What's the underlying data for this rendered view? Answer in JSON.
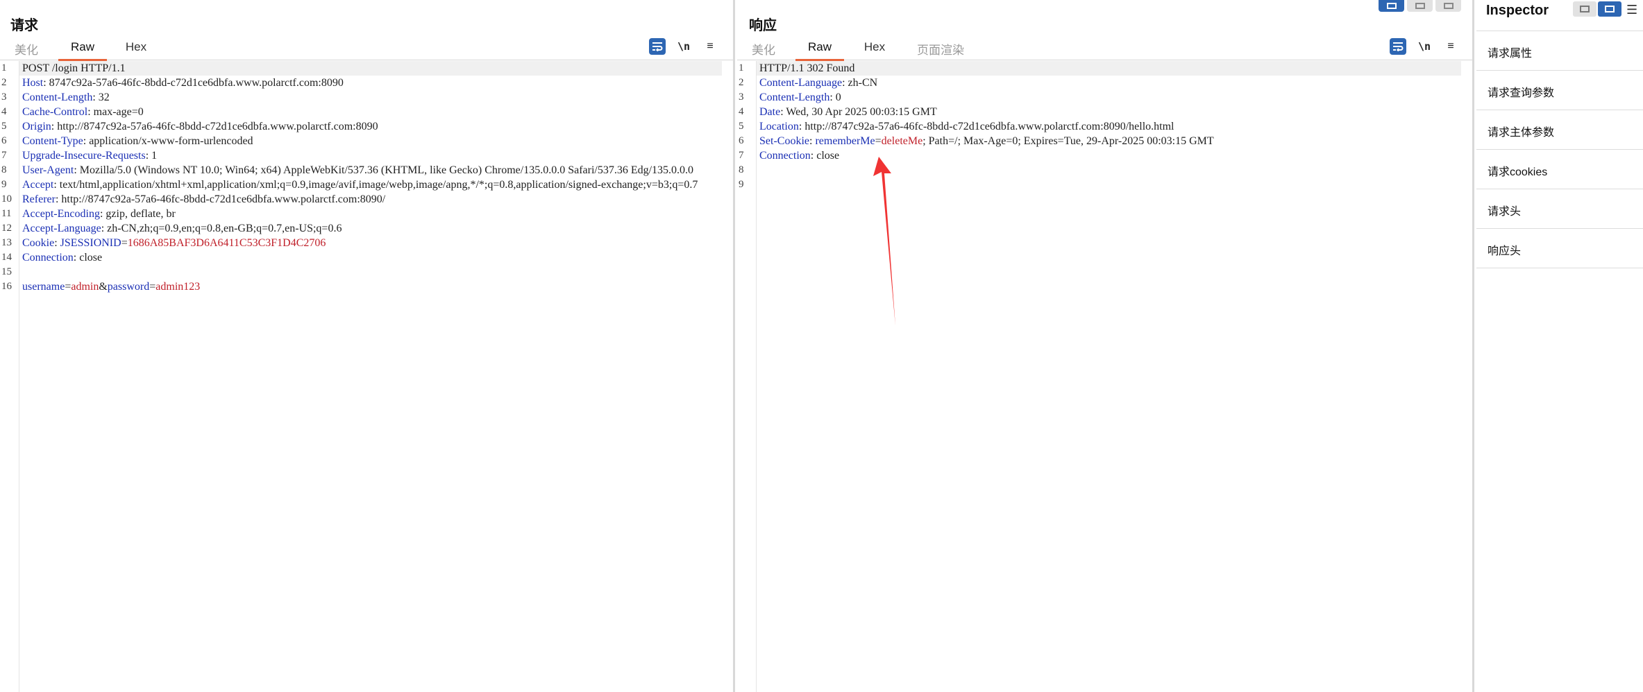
{
  "request": {
    "title": "请求",
    "tabs": [
      "美化",
      "Raw",
      "Hex"
    ],
    "active_tab": "Raw",
    "toolbar": {
      "newline_label": "\\n",
      "menu_label": "≡"
    },
    "lines": [
      [
        {
          "t": "POST /login HTTP/1.1",
          "c": ""
        }
      ],
      [
        {
          "t": "Host",
          "c": "hk"
        },
        {
          "t": ": 8747c92a-57a6-46fc-8bdd-c72d1ce6dbfa.www.polarctf.com:8090",
          "c": "hv"
        }
      ],
      [
        {
          "t": "Content-Length",
          "c": "hk"
        },
        {
          "t": ": 32",
          "c": "hv"
        }
      ],
      [
        {
          "t": "Cache-Control",
          "c": "hk"
        },
        {
          "t": ": max-age=0",
          "c": "hv"
        }
      ],
      [
        {
          "t": "Origin",
          "c": "hk"
        },
        {
          "t": ": http://8747c92a-57a6-46fc-8bdd-c72d1ce6dbfa.www.polarctf.com:8090",
          "c": "hv"
        }
      ],
      [
        {
          "t": "Content-Type",
          "c": "hk"
        },
        {
          "t": ": application/x-www-form-urlencoded",
          "c": "hv"
        }
      ],
      [
        {
          "t": "Upgrade-Insecure-Requests",
          "c": "hk"
        },
        {
          "t": ": 1",
          "c": "hv"
        }
      ],
      [
        {
          "t": "User-Agent",
          "c": "hk"
        },
        {
          "t": ": Mozilla/5.0 (Windows NT 10.0; Win64; x64) AppleWebKit/537.36 (KHTML, like Gecko) Chrome/135.0.0.0 Safari/537.36 Edg/135.0.0.0",
          "c": "hv"
        }
      ],
      [
        {
          "t": "Accept",
          "c": "hk"
        },
        {
          "t": ": text/html,application/xhtml+xml,application/xml;q=0.9,image/avif,image/webp,image/apng,*/*;q=0.8,application/signed-exchange;v=b3;q=0.7",
          "c": "hv"
        }
      ],
      [
        {
          "t": "Referer",
          "c": "hk"
        },
        {
          "t": ": http://8747c92a-57a6-46fc-8bdd-c72d1ce6dbfa.www.polarctf.com:8090/",
          "c": "hv"
        }
      ],
      [
        {
          "t": "Accept-Encoding",
          "c": "hk"
        },
        {
          "t": ": gzip, deflate, br",
          "c": "hv"
        }
      ],
      [
        {
          "t": "Accept-Language",
          "c": "hk"
        },
        {
          "t": ": zh-CN,zh;q=0.9,en;q=0.8,en-GB;q=0.7,en-US;q=0.6",
          "c": "hv"
        }
      ],
      [
        {
          "t": "Cookie",
          "c": "hk"
        },
        {
          "t": ": ",
          "c": "hv"
        },
        {
          "t": "JSESSIONID",
          "c": "pk"
        },
        {
          "t": "=",
          "c": "hv"
        },
        {
          "t": "1686A85BAF3D6A6411C53C3F1D4C2706",
          "c": "pv"
        }
      ],
      [
        {
          "t": "Connection",
          "c": "hk"
        },
        {
          "t": ": close",
          "c": "hv"
        }
      ],
      [
        {
          "t": "",
          "c": ""
        }
      ],
      [
        {
          "t": "username",
          "c": "pk"
        },
        {
          "t": "=",
          "c": "hv"
        },
        {
          "t": "admin",
          "c": "pv"
        },
        {
          "t": "&",
          "c": "hv"
        },
        {
          "t": "password",
          "c": "pk"
        },
        {
          "t": "=",
          "c": "hv"
        },
        {
          "t": "admin123",
          "c": "pv"
        }
      ]
    ]
  },
  "response": {
    "title": "响应",
    "tabs": [
      "美化",
      "Raw",
      "Hex",
      "页面渲染"
    ],
    "active_tab": "Raw",
    "toolbar": {
      "newline_label": "\\n",
      "menu_label": "≡"
    },
    "lines": [
      [
        {
          "t": "HTTP/1.1 302 Found",
          "c": ""
        }
      ],
      [
        {
          "t": "Content-Language",
          "c": "hk"
        },
        {
          "t": ": zh-CN",
          "c": "hv"
        }
      ],
      [
        {
          "t": "Content-Length",
          "c": "hk"
        },
        {
          "t": ": 0",
          "c": "hv"
        }
      ],
      [
        {
          "t": "Date",
          "c": "hk"
        },
        {
          "t": ": Wed, 30 Apr 2025 00:03:15 GMT",
          "c": "hv"
        }
      ],
      [
        {
          "t": "Location",
          "c": "hk"
        },
        {
          "t": ": http://8747c92a-57a6-46fc-8bdd-c72d1ce6dbfa.www.polarctf.com:8090/hello.html",
          "c": "hv"
        }
      ],
      [
        {
          "t": "Set-Cookie",
          "c": "hk"
        },
        {
          "t": ": ",
          "c": "hv"
        },
        {
          "t": "rememberMe",
          "c": "pk"
        },
        {
          "t": "=",
          "c": "hv"
        },
        {
          "t": "deleteMe",
          "c": "pv"
        },
        {
          "t": "; Path=/; Max-Age=0; Expires=Tue, 29-Apr-2025 00:03:15 GMT",
          "c": "hv"
        }
      ],
      [
        {
          "t": "Connection",
          "c": "hk"
        },
        {
          "t": ": close",
          "c": "hv"
        }
      ],
      [
        {
          "t": "",
          "c": ""
        }
      ],
      [
        {
          "t": "",
          "c": ""
        }
      ]
    ]
  },
  "inspector": {
    "title": "Inspector",
    "more_label": "☰",
    "sections": [
      "请求属性",
      "请求查询参数",
      "请求主体参数",
      "请求cookies",
      "请求头",
      "响应头"
    ]
  },
  "colors": {
    "accent": "#2d66b3",
    "active_tab_underline": "#e8643a",
    "header_key": "#1a2fb4",
    "param_value": "#c0202a",
    "annotation_arrow": "#f03333"
  }
}
